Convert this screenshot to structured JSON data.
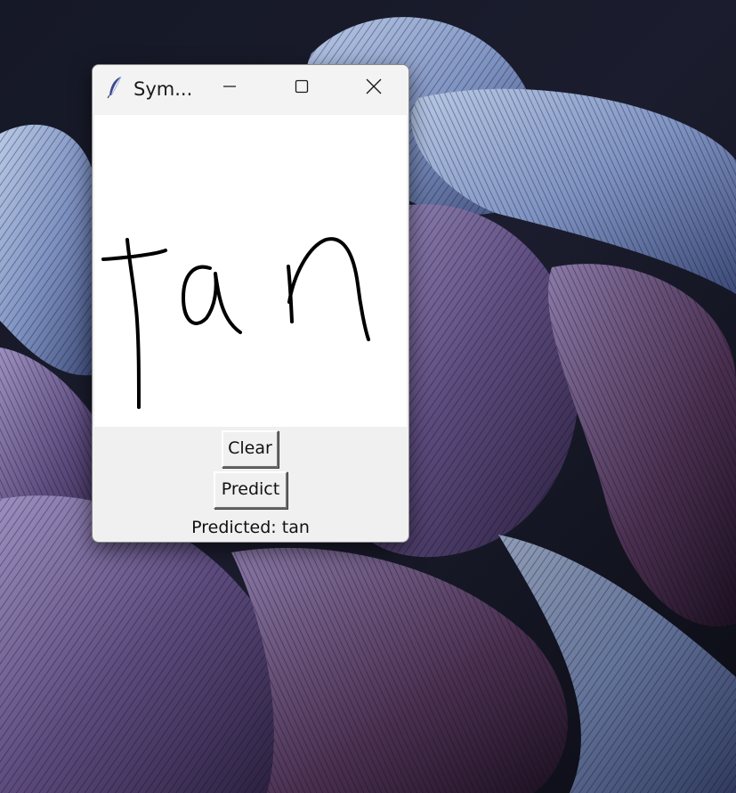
{
  "window": {
    "title": "Sym...",
    "icon": "feather-icon"
  },
  "controls": {
    "minimize_icon": "minimize-icon",
    "maximize_icon": "maximize-icon",
    "close_icon": "close-icon"
  },
  "canvas": {
    "drawn_text": "tan",
    "ink_color": "#000000",
    "background": "#ffffff"
  },
  "buttons": {
    "clear_label": "Clear",
    "predict_label": "Predict"
  },
  "result": {
    "text": "Predicted: tan"
  },
  "colors": {
    "window_bg": "#f0f0f0",
    "titlebar_bg": "#f3f3f3",
    "wallpaper_base": "#0d0f1a"
  }
}
